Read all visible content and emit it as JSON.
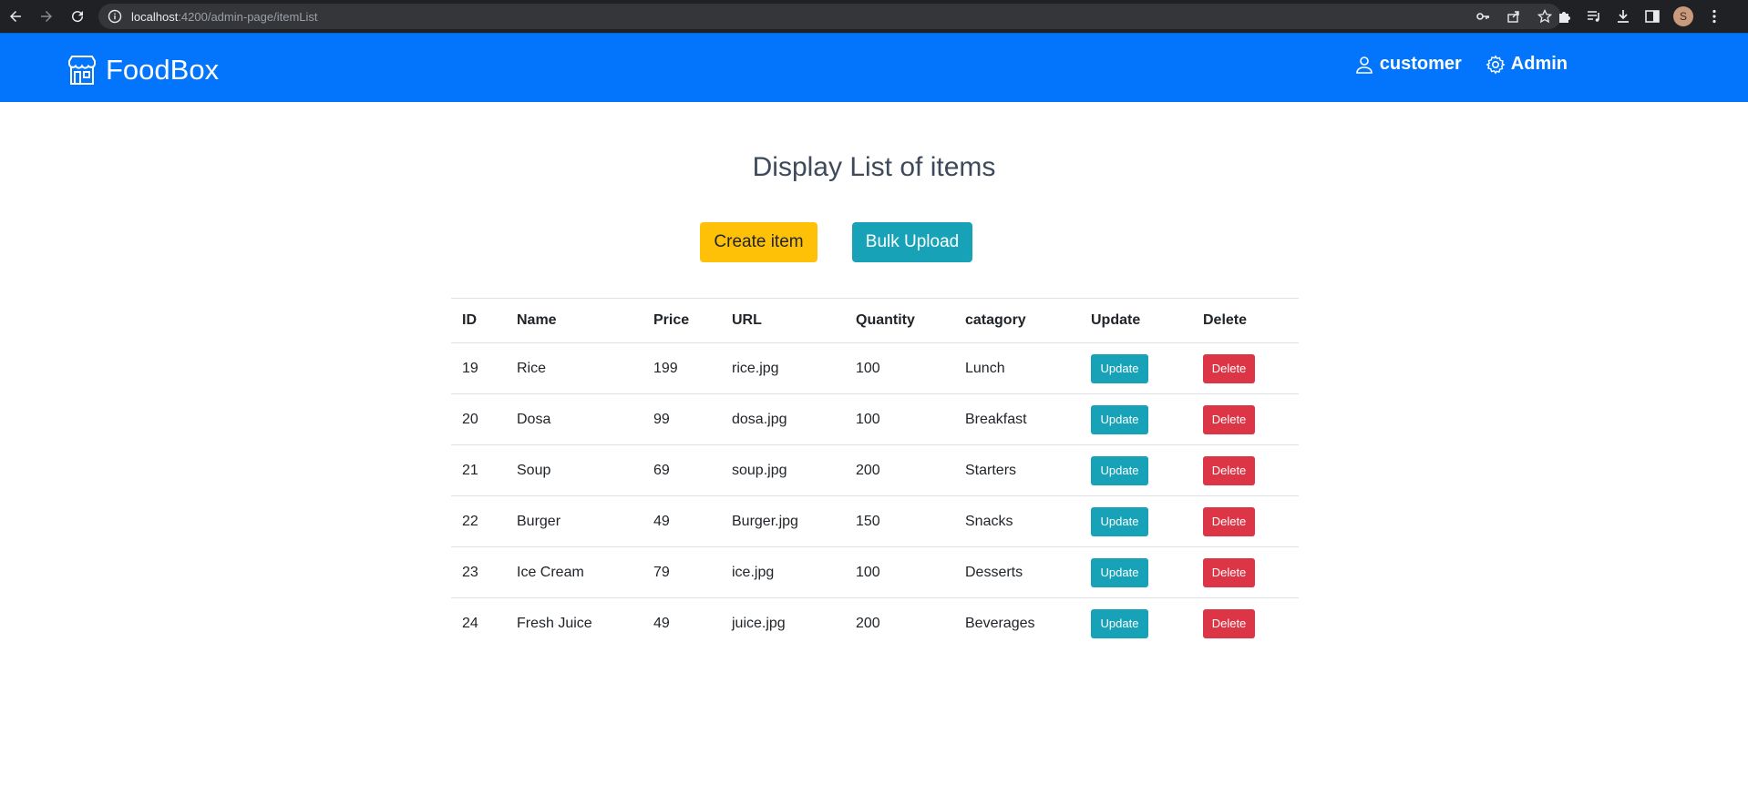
{
  "browser": {
    "url_host": "localhost",
    "url_path": ":4200/admin-page/itemList",
    "profile_initial": "S"
  },
  "navbar": {
    "brand": "FoodBox",
    "links": {
      "customer": "customer",
      "admin": "Admin"
    },
    "color": "#0275fc"
  },
  "page": {
    "title": "Display List of items",
    "create_label": "Create item",
    "bulk_label": "Bulk Upload"
  },
  "table": {
    "headers": [
      "ID",
      "Name",
      "Price",
      "URL",
      "Quantity",
      "catagory",
      "Update",
      "Delete"
    ],
    "update_label": "Update",
    "delete_label": "Delete",
    "rows": [
      {
        "id": "19",
        "name": "Rice",
        "price": "199",
        "url": "rice.jpg",
        "quantity": "100",
        "category": "Lunch"
      },
      {
        "id": "20",
        "name": "Dosa",
        "price": "99",
        "url": "dosa.jpg",
        "quantity": "100",
        "category": "Breakfast"
      },
      {
        "id": "21",
        "name": "Soup",
        "price": "69",
        "url": "soup.jpg",
        "quantity": "200",
        "category": "Starters"
      },
      {
        "id": "22",
        "name": "Burger",
        "price": "49",
        "url": "Burger.jpg",
        "quantity": "150",
        "category": "Snacks"
      },
      {
        "id": "23",
        "name": "Ice Cream",
        "price": "79",
        "url": "ice.jpg",
        "quantity": "100",
        "category": "Desserts"
      },
      {
        "id": "24",
        "name": "Fresh Juice",
        "price": "49",
        "url": "juice.jpg",
        "quantity": "200",
        "category": "Beverages"
      }
    ]
  },
  "colors": {
    "warning": "#ffc107",
    "info": "#17a2b8",
    "danger": "#dc3545"
  }
}
